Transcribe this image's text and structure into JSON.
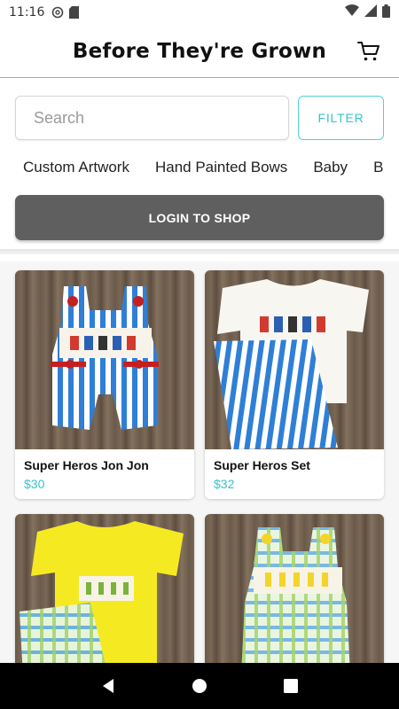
{
  "status_bar": {
    "time": "11:16",
    "icons": [
      "at-sign-icon",
      "sd-card-icon",
      "wifi-icon",
      "cell-signal-icon",
      "battery-icon"
    ]
  },
  "header": {
    "title": "Before They're Grown",
    "cart_icon": "cart-icon",
    "accent_color": "#4fd1d9"
  },
  "search": {
    "placeholder": "Search",
    "value": ""
  },
  "filter": {
    "label": "FILTER"
  },
  "categories": [
    "Custom Artwork",
    "Hand Painted Bows",
    "Baby",
    "B"
  ],
  "login": {
    "label": "LOGIN TO SHOP",
    "color": "#5f5f5f"
  },
  "products": [
    {
      "name": "Super Heros Jon Jon",
      "price": "$30"
    },
    {
      "name": "Super Heros Set",
      "price": "$32"
    },
    {
      "name": "",
      "price": ""
    },
    {
      "name": "",
      "price": ""
    }
  ],
  "nav_bar": {
    "icons": [
      "back-icon",
      "home-icon",
      "recents-icon"
    ]
  }
}
